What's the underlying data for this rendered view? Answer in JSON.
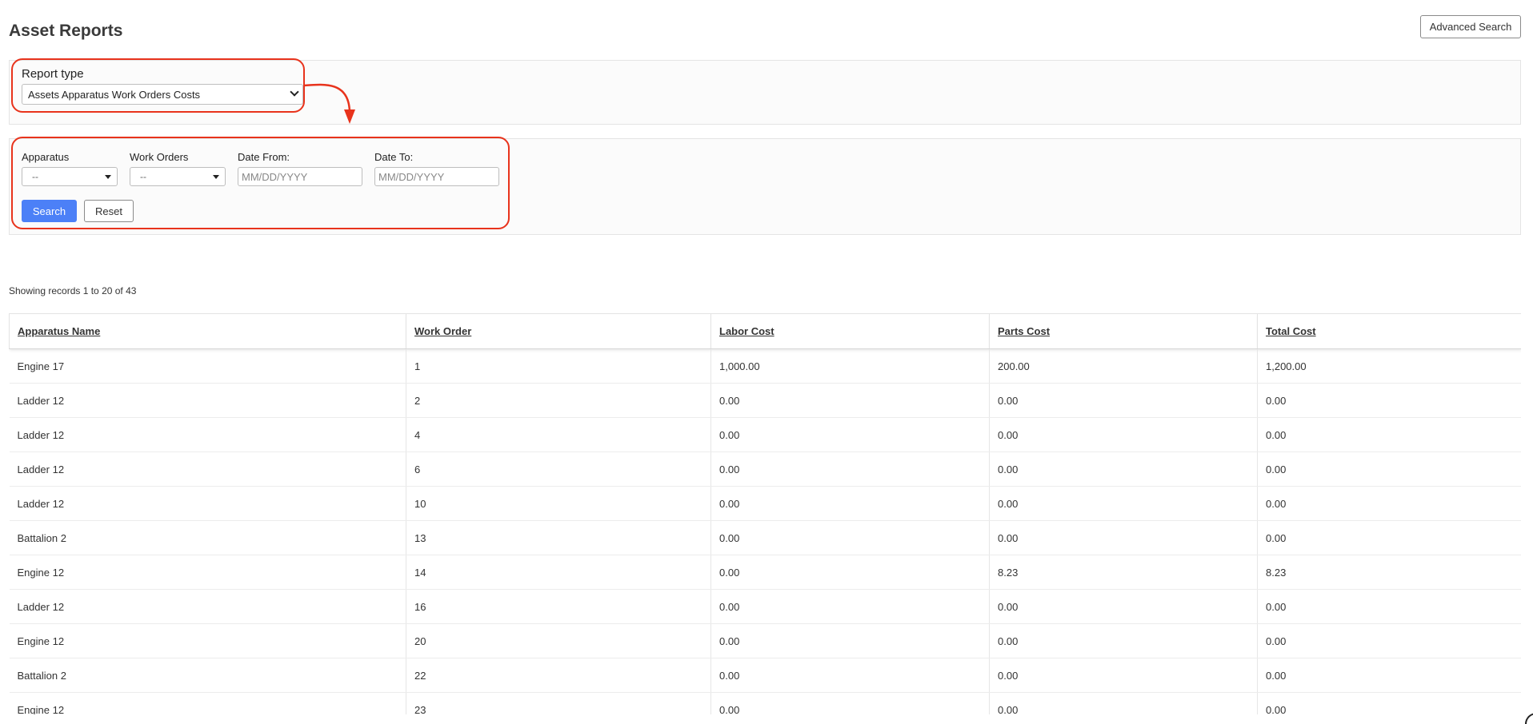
{
  "page": {
    "title": "Asset Reports",
    "advanced_search_label": "Advanced Search"
  },
  "report": {
    "label": "Report type",
    "selected": "Assets Apparatus Work Orders Costs"
  },
  "filters": {
    "apparatus_label": "Apparatus",
    "apparatus_value": "--",
    "work_orders_label": "Work Orders",
    "work_orders_value": "--",
    "date_from_label": "Date From:",
    "date_from_placeholder": "MM/DD/YYYY",
    "date_to_label": "Date To:",
    "date_to_placeholder": "MM/DD/YYYY",
    "search_label": "Search",
    "reset_label": "Reset"
  },
  "results": {
    "summary": "Showing records 1 to 20 of 43",
    "columns": [
      "Apparatus Name",
      "Work Order",
      "Labor Cost",
      "Parts Cost",
      "Total Cost"
    ],
    "rows": [
      [
        "Engine 17",
        "1",
        "1,000.00",
        "200.00",
        "1,200.00"
      ],
      [
        "Ladder 12",
        "2",
        "0.00",
        "0.00",
        "0.00"
      ],
      [
        "Ladder 12",
        "4",
        "0.00",
        "0.00",
        "0.00"
      ],
      [
        "Ladder 12",
        "6",
        "0.00",
        "0.00",
        "0.00"
      ],
      [
        "Ladder 12",
        "10",
        "0.00",
        "0.00",
        "0.00"
      ],
      [
        "Battalion 2",
        "13",
        "0.00",
        "0.00",
        "0.00"
      ],
      [
        "Engine 12",
        "14",
        "0.00",
        "8.23",
        "8.23"
      ],
      [
        "Ladder 12",
        "16",
        "0.00",
        "0.00",
        "0.00"
      ],
      [
        "Engine 12",
        "20",
        "0.00",
        "0.00",
        "0.00"
      ],
      [
        "Battalion 2",
        "22",
        "0.00",
        "0.00",
        "0.00"
      ],
      [
        "Engine 12",
        "23",
        "0.00",
        "0.00",
        "0.00"
      ]
    ]
  },
  "colors": {
    "accent": "#4c80f7",
    "annotation": "#e8331c"
  }
}
